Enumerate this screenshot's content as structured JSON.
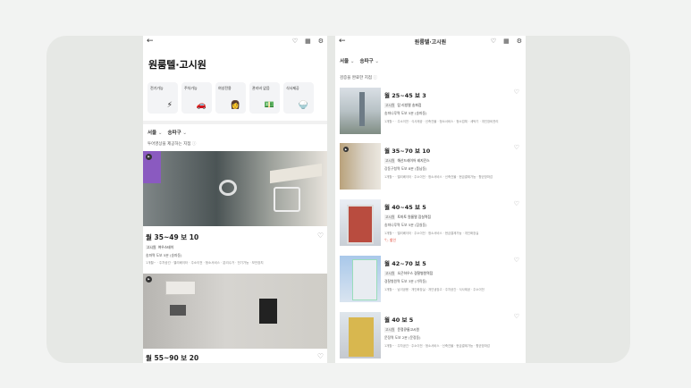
{
  "left_screen": {
    "title": "원룸텔·고시원",
    "categories": [
      {
        "label": "전기가능",
        "icon": "lightning-icon",
        "glyph": "⚡"
      },
      {
        "label": "주차가능",
        "icon": "car-icon",
        "glyph": "🚗"
      },
      {
        "label": "여성전용",
        "icon": "woman-icon",
        "glyph": "👩"
      },
      {
        "label": "관리비 없음",
        "icon": "bill-icon",
        "glyph": "💵"
      },
      {
        "label": "식사제공",
        "icon": "meal-icon",
        "glyph": "🍚"
      }
    ],
    "filters": [
      "서울",
      "송파구"
    ],
    "section_title": "투어영상을 제공하는 지점",
    "listings": [
      {
        "price": "월 35~49  보 10",
        "type": "고시원",
        "name": "여우스테이",
        "address": "송파역 도보 5분 (송파동)",
        "tags": "1개월~ · 주차공간 · 엘리베이터 · 주소이전 · 청소서비스 · 분리수거 · 전기가능 · 보안장치"
      },
      {
        "price": "월 55~90  보 20"
      }
    ]
  },
  "right_screen": {
    "title": "원룸텔·고시원",
    "filters": [
      "서울",
      "송파구"
    ],
    "section_title": "검증을 완료한 지점",
    "listings": [
      {
        "price": "월 25~45  보 3",
        "type": "고시원",
        "name": "탑 리빙텔 송파점",
        "address": "송파나루역 도보 5분 (송파동)",
        "tags": "1개월~ · 주소이전 · 식사제공 · 신축건물 · 청소서비스 · 청소업체 · 세탁기 · 개인장비관리",
        "badge": ""
      },
      {
        "price": "월 35~70  보 10",
        "type": "고시원",
        "name": "해산드레이어 레지던스",
        "address": "강동구청역 도보 8분 (풍납동)",
        "tags": "1개월~ · 엘리베이터 · 주소이전 · 청소서비스 · 신축건물 · 현금결제가능 · 향균방마감",
        "badge": ""
      },
      {
        "price": "월 40~45  보 5",
        "type": "고시원",
        "name": "토마토 원룸텔 잠실역점",
        "address": "송파나루역 도보 5분 (잠실동)",
        "tags": "1개월~ · 엘리베이터 · 주소이전 · 청소서비스 · 현금결제가능 · 개인화장실",
        "badge": "할인"
      },
      {
        "price": "월 42~70  보 5",
        "type": "고시원",
        "name": "오곤하우스 경찰병원역점",
        "address": "경찰병원역 도보 3분 (가락동)",
        "tags": "1개월~ · 남녀공용 · 개인화장실 · 개인냉장고 · 주차공간 · 식사제공 · 주소이전",
        "badge": ""
      },
      {
        "price": "월 40  보 5",
        "type": "고시원",
        "name": "문정큐룸고시원",
        "address": "문정역 도보 2분 (문정동)",
        "tags": "1개월~ · 주차공간 · 주소이전 · 청소서비스 · 신축건물 · 현금결제가능 · 향균방마감",
        "badge": ""
      }
    ]
  }
}
